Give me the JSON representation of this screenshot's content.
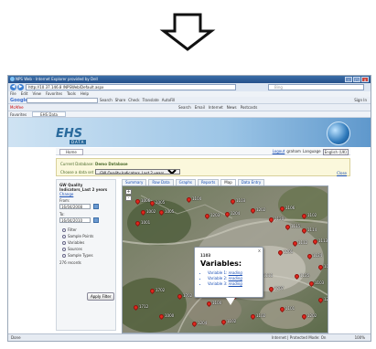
{
  "window": {
    "title": "NPS Web - Internet Explorer provided by Dell",
    "buttons": {
      "minimize": "–",
      "maximize": "□",
      "close": "x"
    }
  },
  "address_bar": {
    "back": "◀",
    "forward": "▶",
    "url": "http://10.37.146.8 /NPSWeb/Default.aspx",
    "search_placeholder": "Bing"
  },
  "menu": [
    "File",
    "Edit",
    "View",
    "Favorites",
    "Tools",
    "Help"
  ],
  "google_toolbar": {
    "logo": "Google",
    "buttons": [
      "Search",
      "Share",
      "Check",
      "Translate",
      "AutoFill"
    ],
    "sign_in": "Sign In"
  },
  "command_bar": {
    "left": "McAfee",
    "right": [
      "Search",
      "Email",
      "Internet",
      "News",
      "Postcasts"
    ]
  },
  "favorites_bar": {
    "favorites": "Favorites",
    "tab": "EHS Data"
  },
  "site": {
    "logo": "EHS",
    "logo_sub": "DATA",
    "home_button": "Home",
    "logout": "Logout",
    "user": "graham",
    "language_label": "Language",
    "language_value": "English (UK)"
  },
  "database_bar": {
    "current_label": "Current Database:",
    "current_value": "Demo Database",
    "choose_label": "Choose a data set",
    "dataset_value": "GW Quality Indicators_Last 2 years",
    "close": "Close"
  },
  "filter": {
    "title": "GW Quality Indicators_Last 2 years",
    "change": "Change",
    "from_label": "From:",
    "from_value": "16/04/2008",
    "to_label": "To:",
    "to_value": "16/04/2010",
    "options": [
      "Filter",
      "Sample Points",
      "Variables",
      "Sources",
      "Sample Types"
    ],
    "records": "276 records",
    "apply": "Apply Filter"
  },
  "tabs": [
    "Summary",
    "Raw Data",
    "Graphs",
    "Reports",
    "Map",
    "Data Entry"
  ],
  "active_tab": "Map",
  "map": {
    "labels": [
      "1006",
      "1005",
      "1104",
      "1103",
      "1002",
      "1005",
      "1001",
      "1203",
      "1204",
      "1202",
      "1106",
      "1102",
      "1120",
      "1115",
      "1114",
      "1113",
      "1112",
      "1124",
      "1014",
      "1125",
      "1201",
      "1103",
      "1207",
      "1111",
      "1702",
      "1702",
      "1100",
      "1000",
      "1712",
      "1000",
      "1204",
      "1102",
      "1102",
      "1101",
      "1202",
      "1203"
    ],
    "zoom_in": "+",
    "zoom_out": "-"
  },
  "popup": {
    "id": "1103",
    "title": "Variables:",
    "variables": [
      {
        "name": "Variable 1:",
        "reading": "reading"
      },
      {
        "name": "Variable 2:",
        "reading": "reading"
      },
      {
        "name": "Variable 3:",
        "reading": "reading"
      }
    ],
    "close": "x"
  },
  "status_bar": {
    "left": "Done",
    "zone": "Internet | Protected Mode: On",
    "zoom": "100%"
  }
}
